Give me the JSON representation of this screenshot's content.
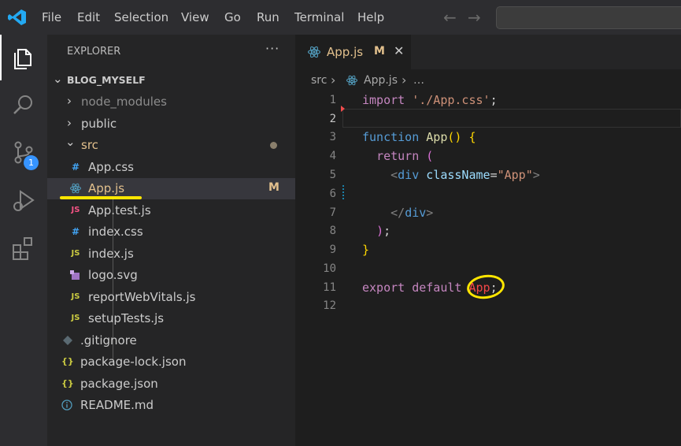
{
  "menu": [
    "File",
    "Edit",
    "Selection",
    "View",
    "Go",
    "Run",
    "Terminal",
    "Help"
  ],
  "activity": {
    "source_control_badge": "1"
  },
  "sidebar": {
    "title": "EXPLORER",
    "more": "···",
    "section": "BLOG_MYSELF",
    "tree": [
      {
        "label": "node_modules",
        "type": "folder",
        "state": "collapsed",
        "dim": true
      },
      {
        "label": "public",
        "type": "folder",
        "state": "collapsed"
      },
      {
        "label": "src",
        "type": "folder",
        "state": "expanded",
        "modified": true
      },
      {
        "label": "App.css",
        "icon": "#",
        "icon_color": "#42a5f5"
      },
      {
        "label": "App.js",
        "icon": "react",
        "icon_color": "#519aba",
        "badge": "M",
        "selected": true
      },
      {
        "label": "App.test.js",
        "icon": "JS",
        "icon_color": "#f55385"
      },
      {
        "label": "index.css",
        "icon": "#",
        "icon_color": "#42a5f5"
      },
      {
        "label": "index.js",
        "icon": "JS",
        "icon_color": "#cbcb41"
      },
      {
        "label": "logo.svg",
        "icon": "svg",
        "icon_color": "#a074c4"
      },
      {
        "label": "reportWebVitals.js",
        "icon": "JS",
        "icon_color": "#cbcb41"
      },
      {
        "label": "setupTests.js",
        "icon": "JS",
        "icon_color": "#cbcb41"
      },
      {
        "label": ".gitignore",
        "icon": "git",
        "icon_color": "#41535b"
      },
      {
        "label": "package-lock.json",
        "icon": "{}",
        "icon_color": "#cbcb41"
      },
      {
        "label": "package.json",
        "icon": "{}",
        "icon_color": "#cbcb41"
      },
      {
        "label": "README.md",
        "icon": "info",
        "icon_color": "#519aba"
      }
    ]
  },
  "tab": {
    "label": "App.js",
    "status": "M",
    "close": "✕"
  },
  "breadcrumb": {
    "folder": "src",
    "file": "App.js",
    "more": "…"
  },
  "code": {
    "line_numbers": [
      "1",
      "2",
      "3",
      "4",
      "5",
      "6",
      "7",
      "8",
      "9",
      "10",
      "11",
      "12"
    ],
    "l1_kw": "import",
    "l1_str": "'./App.css'",
    "l1_end": ";",
    "l3_kw": "function",
    "l3_fn": "App",
    "l3_paren": "()",
    "l3_brace": "{",
    "l4_kw": "return",
    "l4_paren": "(",
    "l5_open": "<",
    "l5_tag": "div",
    "l5_attr": "className",
    "l5_eq": "=",
    "l5_val": "\"App\"",
    "l5_close": ">",
    "l7_open": "</",
    "l7_tag": "div",
    "l7_close": ">",
    "l8_paren": ")",
    "l8_end": ";",
    "l9_brace": "}",
    "l11_kw1": "export",
    "l11_kw2": "default",
    "l11_ident": "App",
    "l11_end": ";"
  }
}
